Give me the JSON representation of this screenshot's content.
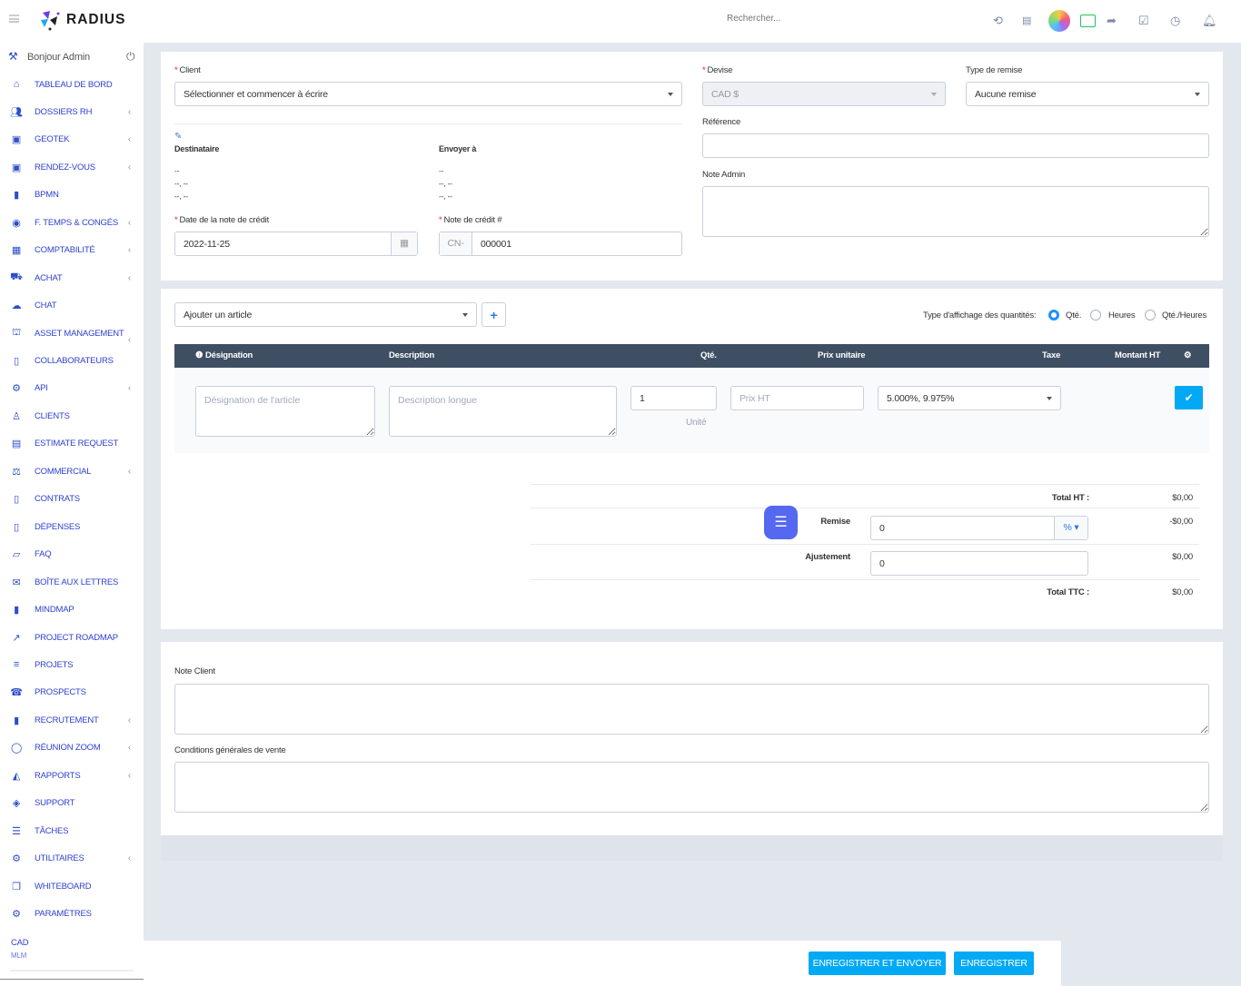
{
  "topbar": {
    "logo_text": "RADIUS",
    "search_placeholder": "Rechercher...",
    "icons": [
      "history-icon",
      "id-card-icon",
      "globe-avatar-icon",
      "chat-user-icon",
      "share-icon",
      "checkbox-icon",
      "clock-icon",
      "bell-icon"
    ]
  },
  "sidebar": {
    "greeting": "Bonjour Admin",
    "items": [
      {
        "label": "TABLEAU DE BORD",
        "icon": "home-icon",
        "chevron": false
      },
      {
        "label": "DOSSIERS RH",
        "icon": "users-icon",
        "chevron": true
      },
      {
        "label": "GEOTEK",
        "icon": "calendar-check-icon",
        "chevron": true
      },
      {
        "label": "RENDEZ-VOUS",
        "icon": "calendar-check-icon",
        "chevron": true
      },
      {
        "label": "BPMN",
        "icon": "map-icon",
        "chevron": false
      },
      {
        "label": "F. TEMPS & CONGÉS",
        "icon": "user-circle-icon",
        "chevron": true
      },
      {
        "label": "COMPTABILITÉ",
        "icon": "table-icon",
        "chevron": true
      },
      {
        "label": "ACHAT",
        "icon": "cart-icon",
        "chevron": true
      },
      {
        "label": "CHAT",
        "icon": "comments-icon",
        "chevron": false
      },
      {
        "label": "ASSET MANAGEMENT",
        "icon": "bank-icon",
        "chevron": true
      },
      {
        "label": "COLLABORATEURS",
        "icon": "file-icon",
        "chevron": false
      },
      {
        "label": "API",
        "icon": "cogs-icon",
        "chevron": true
      },
      {
        "label": "CLIENTS",
        "icon": "user-icon",
        "chevron": false
      },
      {
        "label": "ESTIMATE REQUEST",
        "icon": "list-alt-icon",
        "chevron": false
      },
      {
        "label": "COMMERCIAL",
        "icon": "balance-icon",
        "chevron": true
      },
      {
        "label": "CONTRATS",
        "icon": "file-icon",
        "chevron": false
      },
      {
        "label": "DÉPENSES",
        "icon": "file-text-icon",
        "chevron": false
      },
      {
        "label": "FAQ",
        "icon": "folder-open-icon",
        "chevron": false
      },
      {
        "label": "BOÎTE AUX LETTRES",
        "icon": "envelope-icon",
        "chevron": false
      },
      {
        "label": "MINDMAP",
        "icon": "map-icon",
        "chevron": false
      },
      {
        "label": "PROJECT ROADMAP",
        "icon": "line-chart-icon",
        "chevron": false
      },
      {
        "label": "PROJETS",
        "icon": "bars-icon",
        "chevron": false
      },
      {
        "label": "PROSPECTS",
        "icon": "tty-icon",
        "chevron": false
      },
      {
        "label": "RECRUTEMENT",
        "icon": "address-book-icon",
        "chevron": true
      },
      {
        "label": "RÉUNION ZOOM",
        "icon": "comment-icon",
        "chevron": true
      },
      {
        "label": "RAPPORTS",
        "icon": "area-chart-icon",
        "chevron": true
      },
      {
        "label": "SUPPORT",
        "icon": "ticket-icon",
        "chevron": false
      },
      {
        "label": "TÂCHES",
        "icon": "tasks-icon",
        "chevron": false
      },
      {
        "label": "UTILITAIRES",
        "icon": "cogs-icon",
        "chevron": true
      },
      {
        "label": "WHITEBOARD",
        "icon": "clone-icon",
        "chevron": false
      },
      {
        "label": "PARAMÈTRES",
        "icon": "gear-icon",
        "chevron": false
      }
    ],
    "footer_currency": "CAD",
    "footer_sub": "MLM"
  },
  "form": {
    "client_label": "Client",
    "client_placeholder": "Sélectionner et commencer à écrire",
    "devise_label": "Devise",
    "devise_value": "CAD $",
    "remise_type_label": "Type de remise",
    "remise_type_value": "Aucune remise",
    "reference_label": "Référence",
    "reference_value": "",
    "note_admin_label": "Note Admin",
    "note_admin_value": "",
    "destinataire_label": "Destinataire",
    "destinataire_lines": [
      "--",
      "--, --",
      "--, --"
    ],
    "envoyer_label": "Envoyer à",
    "envoyer_lines": [
      "--",
      "--, --",
      "--, --"
    ],
    "date_label": "Date de la note de crédit",
    "date_value": "2022-11-25",
    "number_label": "Note de crédit #",
    "number_prefix": "CN-",
    "number_value": "000001"
  },
  "items": {
    "add_placeholder": "Ajouter un article",
    "add_button": "+",
    "qty_type_label": "Type d'affichage des quantités:",
    "qty_options": [
      {
        "label": "Qté.",
        "checked": true
      },
      {
        "label": "Heures",
        "checked": false
      },
      {
        "label": "Qté./Heures",
        "checked": false
      }
    ],
    "columns": [
      "Désignation",
      "Description",
      "Qté.",
      "Prix unitaire",
      "Taxe",
      "Montant HT"
    ],
    "row": {
      "designation_placeholder": "Désignation de l'article",
      "description_placeholder": "Description longue",
      "qty": "1",
      "unit_placeholder": "Unité",
      "price_placeholder": "Prix HT",
      "tax": "5.000%, 9.975%"
    },
    "accent": "#03a9f4",
    "header_bg": "#3f4f63"
  },
  "totals": {
    "total_ht_label": "Total HT :",
    "total_ht": "$0,00",
    "remise_label": "Remise",
    "remise_value": "0",
    "remise_unit": "%",
    "remise_amount": "-$0,00",
    "ajustement_label": "Ajustement",
    "ajustement_value": "0",
    "ajustement_amount": "$0,00",
    "total_ttc_label": "Total TTC :",
    "total_ttc": "$0,00"
  },
  "notes": {
    "client_label": "Note Client",
    "client_value": "",
    "cgv_label": "Conditions générales de vente",
    "cgv_value": ""
  },
  "footer": {
    "save_send": "ENREGISTRER ET ENVOYER",
    "save": "ENREGISTRER"
  }
}
